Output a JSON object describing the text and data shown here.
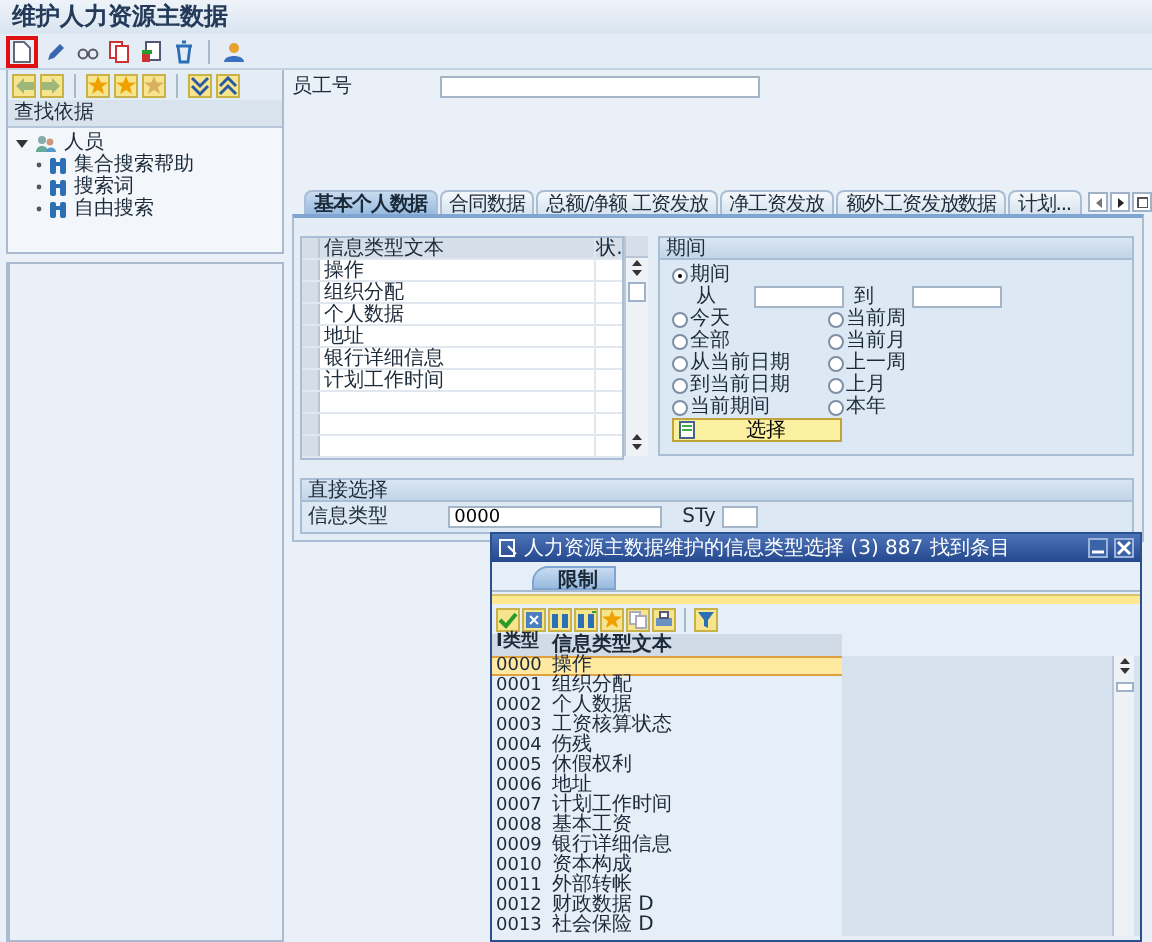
{
  "window": {
    "title": "维护人力资源主数据"
  },
  "toolbar": [
    [
      {
        "kind": "new",
        "highlighted": true
      },
      {
        "kind": "edit",
        "highlighted": false
      },
      {
        "kind": "display",
        "highlighted": false
      },
      {
        "kind": "copy",
        "highlighted": false
      },
      {
        "kind": "delimit",
        "highlighted": false
      },
      {
        "kind": "delete",
        "highlighted": false
      }
    ],
    [
      {
        "kind": "person",
        "highlighted": false
      }
    ]
  ],
  "find_by": {
    "header": "查找依据",
    "tree": [
      {
        "label": "人员",
        "expanded": true,
        "children": [
          {
            "label": "集合搜索帮助"
          },
          {
            "label": "搜索词"
          },
          {
            "label": "自由搜索"
          }
        ]
      }
    ]
  },
  "employee_field": {
    "label": "员工号"
  },
  "tabs": [
    {
      "label": "基本个人数据",
      "selected": true
    },
    {
      "label": "合同数据",
      "selected": false
    },
    {
      "label": "总额/净额 工资发放",
      "selected": false
    },
    {
      "label": "净工资发放",
      "selected": false
    },
    {
      "label": "额外工资发放数据",
      "selected": false
    },
    {
      "label": "计划...",
      "selected": false
    }
  ],
  "infotype_table": {
    "columns": [
      "信息类型文本",
      "状."
    ],
    "rows": [
      "操作",
      "组织分配",
      "个人数据",
      "地址",
      "银行详细信息",
      "计划工作时间"
    ]
  },
  "period": {
    "title": "期间",
    "main_option": {
      "label": "期间",
      "selected": true
    },
    "from_label": "从",
    "to_label": "到",
    "options": [
      {
        "label": "今天",
        "selected": false
      },
      {
        "label": "当前周",
        "selected": false
      },
      {
        "label": "全部",
        "selected": false
      },
      {
        "label": "当前月",
        "selected": false
      },
      {
        "label": "从当前日期",
        "selected": false
      },
      {
        "label": "上一周",
        "selected": false
      },
      {
        "label": "到当前日期",
        "selected": false
      },
      {
        "label": "上月",
        "selected": false
      },
      {
        "label": "当前期间",
        "selected": false
      },
      {
        "label": "本年",
        "selected": false
      }
    ],
    "button": "选择"
  },
  "direct_selection": {
    "title": "直接选择",
    "infotype_label": "信息类型",
    "infotype_value": "0000",
    "subtype_label": "STy"
  },
  "dialog": {
    "title": "人力资源主数据维护的信息类型选择 (3) 887 找到条目",
    "tabs": [
      {
        "label": "限制",
        "selected": true
      }
    ],
    "columns": [
      "I类型",
      "信息类型文本"
    ],
    "rows": [
      {
        "code": "0000",
        "text": "操作",
        "selected": true
      },
      {
        "code": "0001",
        "text": "组织分配",
        "selected": false
      },
      {
        "code": "0002",
        "text": "个人数据",
        "selected": false
      },
      {
        "code": "0003",
        "text": "工资核算状态",
        "selected": false
      },
      {
        "code": "0004",
        "text": "伤残",
        "selected": false
      },
      {
        "code": "0005",
        "text": "休假权利",
        "selected": false
      },
      {
        "code": "0006",
        "text": "地址",
        "selected": false
      },
      {
        "code": "0007",
        "text": "计划工作时间",
        "selected": false
      },
      {
        "code": "0008",
        "text": "基本工资",
        "selected": false
      },
      {
        "code": "0009",
        "text": "银行详细信息",
        "selected": false
      },
      {
        "code": "0010",
        "text": "资本构成",
        "selected": false
      },
      {
        "code": "0011",
        "text": "外部转帐",
        "selected": false
      },
      {
        "code": "0012",
        "text": "财政数据 D",
        "selected": false
      },
      {
        "code": "0013",
        "text": "社会保险 D",
        "selected": false
      }
    ]
  }
}
